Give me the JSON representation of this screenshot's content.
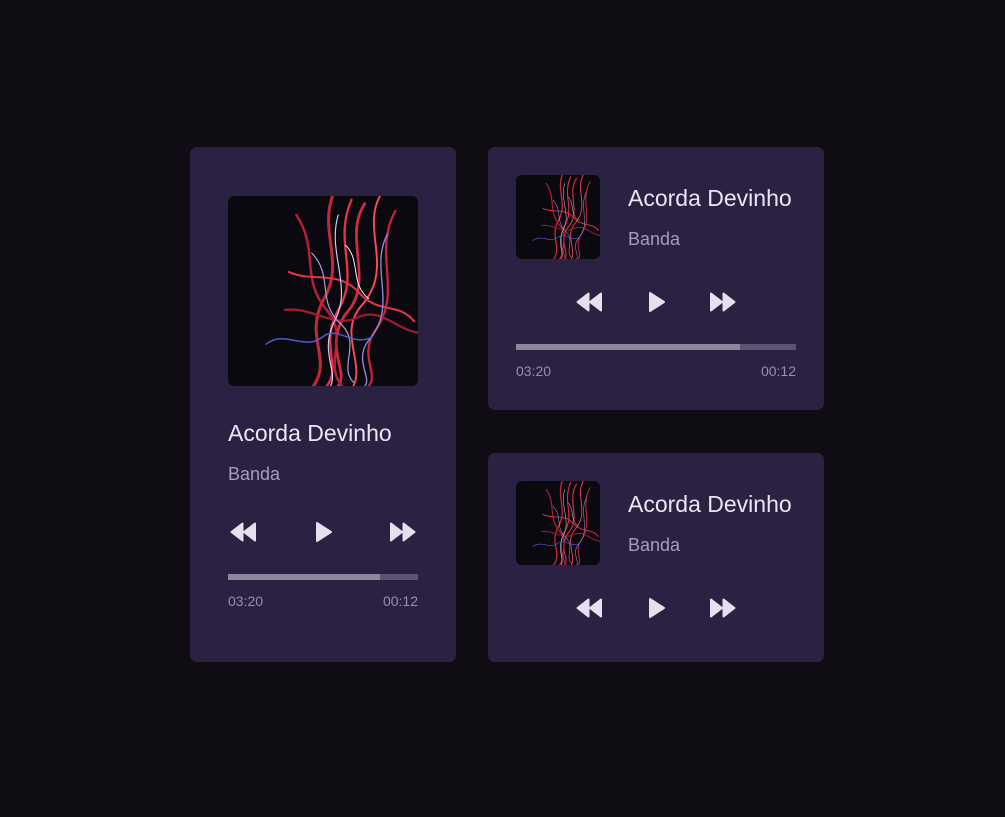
{
  "colors": {
    "background": "#0f0c13",
    "card": "#2b2142",
    "title": "#ece6f4",
    "artist": "#a89cb7",
    "progress_track": "#5e5470",
    "progress_fill": "#8f869c",
    "icon": "#e6e0ee"
  },
  "players": [
    {
      "title": "Acorda Devinho",
      "artist": "Banda",
      "controls": {
        "rewind_icon": "rewind-icon",
        "play_icon": "play-icon",
        "forward_icon": "fast-forward-icon"
      },
      "progress_fraction": 0.8,
      "elapsed": "03:20",
      "remaining": "00:12"
    },
    {
      "title": "Acorda Devinho",
      "artist": "Banda",
      "controls": {
        "rewind_icon": "rewind-icon",
        "play_icon": "play-icon",
        "forward_icon": "fast-forward-icon"
      },
      "progress_fraction": 0.8,
      "elapsed": "03:20",
      "remaining": "00:12"
    },
    {
      "title": "Acorda Devinho",
      "artist": "Banda",
      "controls": {
        "rewind_icon": "rewind-icon",
        "play_icon": "play-icon",
        "forward_icon": "fast-forward-icon"
      }
    }
  ]
}
